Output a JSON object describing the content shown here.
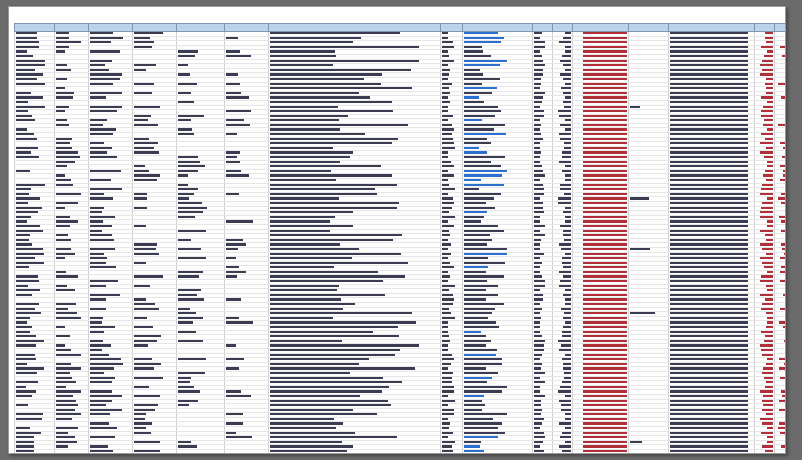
{
  "document": {
    "title_lines": [
      "",
      "",
      ""
    ]
  },
  "table": {
    "columns": [
      "",
      "",
      "",
      "",
      "",
      "",
      "",
      "",
      "",
      "",
      "",
      "",
      "",
      "",
      "",
      "",
      "",
      ""
    ],
    "row_count": 96
  }
}
